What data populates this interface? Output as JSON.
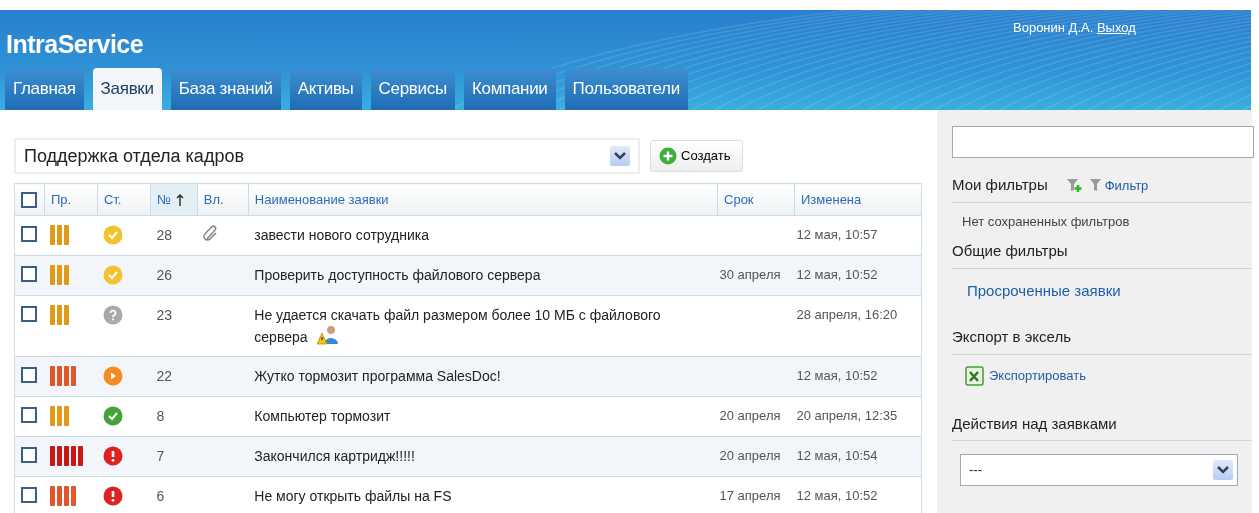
{
  "header": {
    "logo": "IntraService",
    "user": "Воронин Д.А.",
    "logout": "Выход"
  },
  "tabs": [
    {
      "label": "Главная",
      "selected": false
    },
    {
      "label": "Заявки",
      "selected": true
    },
    {
      "label": "База знаний",
      "selected": false
    },
    {
      "label": "Активы",
      "selected": false
    },
    {
      "label": "Сервисы",
      "selected": false
    },
    {
      "label": "Компании",
      "selected": false
    },
    {
      "label": "Пользователи",
      "selected": false
    }
  ],
  "service_select": {
    "value": "Поддержка отдела кадров"
  },
  "create_button": "Создать",
  "table": {
    "select_all": {
      "checked": false
    },
    "columns": [
      "Пр.",
      "Ст.",
      "№",
      "Вл.",
      "Наименование заявки",
      "Срок",
      "Изменена"
    ],
    "rows": [
      {
        "checked": false,
        "priority": {
          "kind": "medium",
          "color": "#e09a1a"
        },
        "status": {
          "kind": "check",
          "color": "#f2c230"
        },
        "number": "28",
        "attachment": true,
        "title": "завести нового сотрудника",
        "user_icon": false,
        "changed": "12 мая, 10:57"
      },
      {
        "checked": false,
        "priority": {
          "kind": "medium",
          "color": "#e09a1a"
        },
        "status": {
          "kind": "check",
          "color": "#f2c230"
        },
        "number": "26",
        "attachment": false,
        "title": "Проверить доступность файлового сервера",
        "user_icon": false,
        "deadline": "30 апреля",
        "changed": "12 мая, 10:52"
      },
      {
        "checked": false,
        "priority": {
          "kind": "medium",
          "color": "#e09a1a"
        },
        "status": {
          "kind": "question",
          "color": "#a9a9a9"
        },
        "number": "23",
        "attachment": false,
        "title": "Не удается скачать файл размером более 10 МБ с файлового сервера",
        "user_icon": true,
        "changed": "28 апреля, 16:20"
      },
      {
        "checked": false,
        "priority": {
          "kind": "high",
          "color": "#e2562a"
        },
        "status": {
          "kind": "play",
          "color": "#f38a22"
        },
        "number": "22",
        "attachment": false,
        "title": "Жутко тормозит программа SalesDoc!",
        "user_icon": false,
        "changed": "12 мая, 10:52"
      },
      {
        "checked": false,
        "priority": {
          "kind": "medium",
          "color": "#e09a1a"
        },
        "status": {
          "kind": "check",
          "color": "#43a33a"
        },
        "number": "8",
        "attachment": false,
        "title": "Компьютер тормозит",
        "user_icon": false,
        "deadline": "20 апреля",
        "changed": "20 апреля, 12:35"
      },
      {
        "checked": false,
        "priority": {
          "kind": "critical",
          "color": "#cc1515"
        },
        "status": {
          "kind": "exclamation",
          "color": "#dd2222"
        },
        "number": "7",
        "attachment": false,
        "title": "Закончился картридж!!!!!",
        "user_icon": false,
        "deadline": "20 апреля",
        "changed": "12 мая, 10:54"
      },
      {
        "checked": false,
        "priority": {
          "kind": "high",
          "color": "#e2562a"
        },
        "status": {
          "kind": "exclamation",
          "color": "#dd2222"
        },
        "number": "6",
        "attachment": false,
        "title": "Не могу открыть файлы на FS",
        "user_icon": false,
        "deadline": "17 апреля",
        "changed": "12 мая, 10:52"
      }
    ]
  },
  "sidebar": {
    "my_filters": {
      "title": "Мои фильтры",
      "filter_link": "Фильтр",
      "empty": "Нет сохраненных фильтров"
    },
    "common_filters": {
      "title": "Общие фильтры",
      "items": [
        "Просроченные заявки"
      ]
    },
    "export": {
      "title": "Экспорт в эксель",
      "link": "Экспортировать"
    },
    "actions": {
      "title": "Действия над заявками",
      "value": "---"
    }
  }
}
